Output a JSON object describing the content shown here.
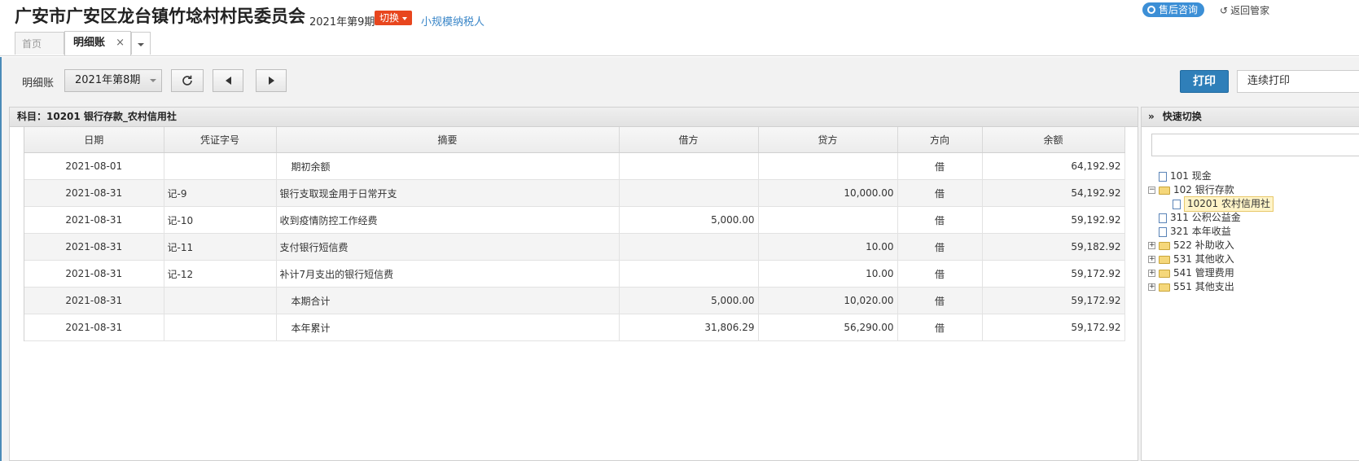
{
  "header": {
    "company": "广安市广安区龙台镇竹埝村村民委员会",
    "period": "2021年第9期",
    "switch_label": "切换",
    "taxpayer_type": "小规模纳税人",
    "consult_label": "售后咨询",
    "back_label": "返回管家"
  },
  "tabs": [
    {
      "label": "首页"
    },
    {
      "label": "明细账",
      "close": "×"
    }
  ],
  "toolbar": {
    "label": "明细账",
    "period_select": "2021年第8期",
    "print_label": "打印",
    "batch_print_label": "连续打印"
  },
  "subject": "科目：10201  银行存款_农村信用社",
  "table": {
    "columns": [
      "日期",
      "凭证字号",
      "摘要",
      "借方",
      "贷方",
      "方向",
      "余额"
    ],
    "rows": [
      {
        "date": "2021-08-01",
        "voucher": "",
        "summary": "期初余额",
        "debit": "",
        "credit": "",
        "direction": "借",
        "balance": "64,192.92",
        "indent": true
      },
      {
        "date": "2021-08-31",
        "voucher": "记-9",
        "summary": "银行支取现金用于日常开支",
        "debit": "",
        "credit": "10,000.00",
        "direction": "借",
        "balance": "54,192.92",
        "indent": false
      },
      {
        "date": "2021-08-31",
        "voucher": "记-10",
        "summary": "收到疫情防控工作经费",
        "debit": "5,000.00",
        "credit": "",
        "direction": "借",
        "balance": "59,192.92",
        "indent": false
      },
      {
        "date": "2021-08-31",
        "voucher": "记-11",
        "summary": "支付银行短信费",
        "debit": "",
        "credit": "10.00",
        "direction": "借",
        "balance": "59,182.92",
        "indent": false
      },
      {
        "date": "2021-08-31",
        "voucher": "记-12",
        "summary": "补计7月支出的银行短信费",
        "debit": "",
        "credit": "10.00",
        "direction": "借",
        "balance": "59,172.92",
        "indent": false
      },
      {
        "date": "2021-08-31",
        "voucher": "",
        "summary": "本期合计",
        "debit": "5,000.00",
        "credit": "10,020.00",
        "direction": "借",
        "balance": "59,172.92",
        "indent": true
      },
      {
        "date": "2021-08-31",
        "voucher": "",
        "summary": "本年累计",
        "debit": "31,806.29",
        "credit": "56,290.00",
        "direction": "借",
        "balance": "59,172.92",
        "indent": true
      }
    ]
  },
  "quick_switch": {
    "title": "快速切换",
    "tree": [
      {
        "label": "101 现金",
        "type": "doc",
        "expander": ""
      },
      {
        "label": "102 银行存款",
        "type": "folder",
        "expander": "−"
      },
      {
        "label": "10201 农村信用社",
        "type": "doc",
        "expander": "",
        "child": true,
        "selected": true
      },
      {
        "label": "311 公积公益金",
        "type": "doc",
        "expander": ""
      },
      {
        "label": "321 本年收益",
        "type": "doc",
        "expander": ""
      },
      {
        "label": "522 补助收入",
        "type": "folder",
        "expander": "+"
      },
      {
        "label": "531 其他收入",
        "type": "folder",
        "expander": "+"
      },
      {
        "label": "541 管理费用",
        "type": "folder",
        "expander": "+"
      },
      {
        "label": "551 其他支出",
        "type": "folder",
        "expander": "+"
      }
    ]
  }
}
